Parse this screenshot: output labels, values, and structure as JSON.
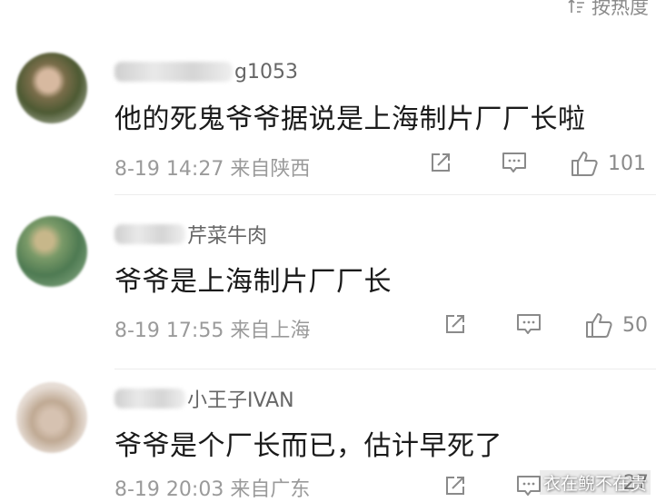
{
  "sort": {
    "label": "按热度",
    "icon": "sort-icon"
  },
  "comments": [
    {
      "username_visible": "g1053",
      "text": "他的死鬼爷爷据说是上海制片厂厂长啦",
      "time": "8-19 14:27",
      "location": "来自陕西",
      "likes": "101"
    },
    {
      "username_visible": "芹菜牛肉",
      "text": "爷爷是上海制片厂厂长",
      "time": "8-19 17:55",
      "location": "来自上海",
      "likes": "50"
    },
    {
      "username_visible": "小王子IVAN",
      "text": "爷爷是个厂长而已，估计早死了",
      "time": "8-19 20:03",
      "location": "来自广东",
      "likes": "27"
    }
  ],
  "watermark": "衣在鲵不在贵",
  "colors": {
    "text": "#1a1a1a",
    "meta": "#9a9a9a",
    "icon": "#8a8a8a"
  }
}
